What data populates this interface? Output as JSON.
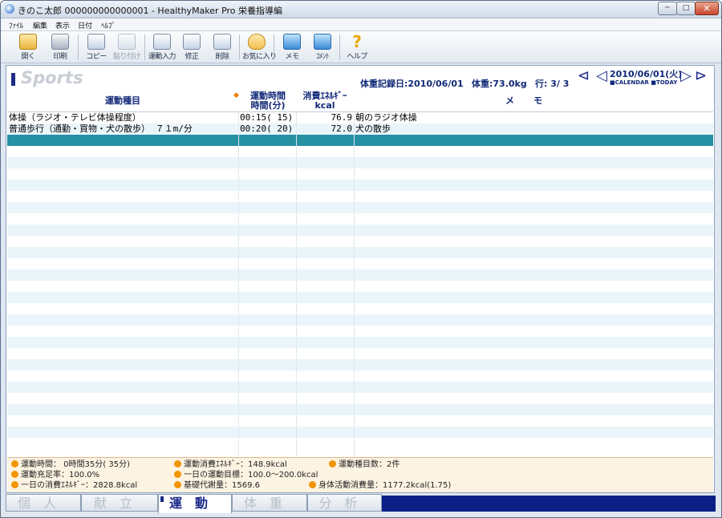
{
  "window": {
    "title": "きのこ太郎 000000000000001 - HealthyMaker Pro 栄養指導編",
    "min": "─",
    "max": "□",
    "close": "✕"
  },
  "menu": [
    "ﾌｧｲﾙ",
    "編集",
    "表示",
    "日付",
    "ﾍﾙﾌﾟ"
  ],
  "toolbar": {
    "open": "開く",
    "print": "印刷",
    "copy": "コピー",
    "paste": "貼り付け",
    "exercise_input": "運動入力",
    "edit": "修正",
    "delete": "削除",
    "favorites": "お気に入り",
    "memo": "メモ",
    "comment": "ｺﾒﾝﾄ",
    "help": "ヘルプ",
    "help_glyph": "?"
  },
  "header": {
    "section": "Sports",
    "record_date": "体重記録日:2010/06/01",
    "weight": "体重:73.0kg",
    "row_info": "行: 3/ 3",
    "current_date": "2010/06/01(火)",
    "calendar_links": "■CALENDAR ■TODAY",
    "nav_first": "⊲",
    "nav_prev": "◁",
    "nav_next": "▷",
    "nav_last": "⊳"
  },
  "table": {
    "columns": {
      "type": "運動種目",
      "time_line1": "運動時間",
      "time_line2": "時間(分)",
      "kcal_line1": "消費ｴﾈﾙｷﾞｰ",
      "kcal_line2": "kcal",
      "memo": "メモ"
    },
    "sort_icon": "◆",
    "rows": [
      {
        "type": "体操（ラジオ・テレビ体操程度）",
        "time": "00:15(  15)",
        "kcal": "76.9",
        "memo": "朝のラジオ体操"
      },
      {
        "type": "普通歩行（通勤・買物・犬の散歩）    ７１m/分",
        "time": "00:20(  20)",
        "kcal": "72.0",
        "memo": "犬の散歩"
      },
      {
        "type": "",
        "time": "",
        "kcal": "",
        "memo": ""
      }
    ]
  },
  "summary": {
    "exercise_time": "運動時間： 0時間35分(  35分)",
    "exercise_kcal": "運動消費ｴﾈﾙｷﾞｰ：148.9kcal",
    "item_count": "運動種目数：2件",
    "fulfillment": "運動充足率：100.0%",
    "daily_target": "一日の運動目標：100.0～200.0kcal",
    "daily_kcal": "一日の消費ｴﾈﾙｷﾞｰ：2828.8kcal",
    "basal": "基礎代謝量：1569.6",
    "activity": "身体活動消費量：1177.2kcal(1.75)"
  },
  "tabs": [
    "個人",
    "献立",
    "運動",
    "体重",
    "分析"
  ]
}
